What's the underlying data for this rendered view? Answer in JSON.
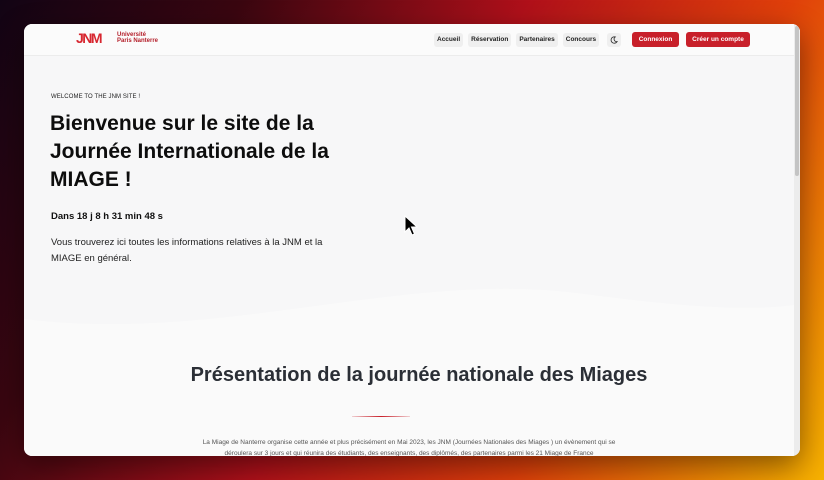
{
  "brand": {
    "mark": "JNM",
    "line1": "Université",
    "line2": "Paris Nanterre"
  },
  "nav": {
    "links": [
      "Accueil",
      "Réservation",
      "Partenaires",
      "Concours"
    ],
    "theme_icon": "moon-icon",
    "login_label": "Connexion",
    "signup_label": "Créer un compte"
  },
  "hero": {
    "kicker": "WELCOME TO THE JNM SITE !",
    "title": "Bienvenue sur le site de la Journée Internationale de la MIAGE !",
    "countdown": "Dans 18 j 8 h 31 min 48 s",
    "intro": "Vous trouverez ici toutes les informations relatives à la JNM et la MIAGE en général."
  },
  "presentation": {
    "title": "Présentation de la journée nationale des Miages",
    "text": "La Miage de Nanterre organise cette année et plus précisément en Mai 2023, les JNM (Journées Nationales des Miages ) un évènement qui se déroulera sur 3 jours et qui réunira des étudiants, des enseignants, des diplômés, des partenaires parmi les 21 Miage de France"
  },
  "colors": {
    "accent": "#c8202a",
    "background": "#f7f7f8",
    "text": "#0d0d0d"
  }
}
